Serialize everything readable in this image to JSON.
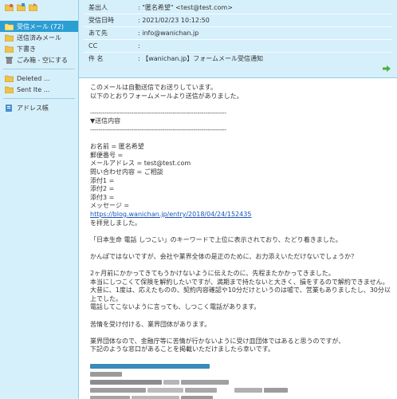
{
  "sidebar": {
    "folders": [
      {
        "label": "受信メール (72)",
        "active": true
      },
      {
        "label": "送信済みメール",
        "active": false
      },
      {
        "label": "下書き",
        "active": false
      },
      {
        "label": "ごみ箱 - 空にする",
        "active": false
      },
      {
        "label": "Deleted ...",
        "active": false
      },
      {
        "label": "Sent Ite ...",
        "active": false
      },
      {
        "label": "アドレス帳",
        "active": false
      }
    ]
  },
  "header": {
    "from_label": "差出人",
    "from_value": ": \"匿名希望\" <test@test.com>",
    "date_label": "受信日時",
    "date_value": ": 2021/02/23 10:12:50",
    "to_label": "あて先",
    "to_value": ": info@wanichan.jp",
    "cc_label": "CC",
    "cc_value": ":",
    "subject_label": "件 名",
    "subject_value": ": 【wanichan.jp】フォームメール受信通知"
  },
  "body": {
    "l1": "このメールは自動送信でお送りしています。",
    "l2": "以下のとおりフォームメールより送信がありました。",
    "dash": "------------------------------------------------------------------",
    "section": "▼送信内容",
    "name": "お名前 = 匿名希望",
    "zip": "郵便番号 =",
    "email": "メールアドレス = test@test.com",
    "inquiry": "問い合わせ内容 = ご相談",
    "att1": "添付1 =",
    "att2": "添付2 =",
    "att3": "添付3 =",
    "message": "メッセージ =",
    "url": "https://blog.wanichan.jp/entry/2018/04/24/152435",
    "after_url": "を拝見しました。",
    "p1": "「日本生命 電話 しつこい」のキーワードで上位に表示されており、たどり着きました。",
    "p2": "かんぽではないですが、会社や業界全体の是正のために、お力添えいただけないでしょうか？",
    "p3a": "2ヶ月前にかかってきてもうかけないように伝えたのに、先程またかかってきました。",
    "p3b": "本当にしつこくて保険を解約したいですが、満期まで持たないと大きく、損をするので解約できません。",
    "p3c": "大昔に、1度は、応えたものの、契約内容確認や10分だけというのは嘘で、営業もありましたし、30分以上でした。",
    "p3d": "電話してこないように言っても、しつこく電話があります。",
    "p4": "苦情を受け付ける、業界団体があります。",
    "p5a": "業界団体なので、金融庁等に苦情が行かないように受け皿団体ではあると思うのですが、",
    "p5b": "下記のような窓口があることを掲載いただけましたら幸いです。"
  },
  "colors": {
    "panel_bg": "#d6f0fb",
    "active_folder": "#2b9ed4",
    "link": "#1a55b8"
  }
}
